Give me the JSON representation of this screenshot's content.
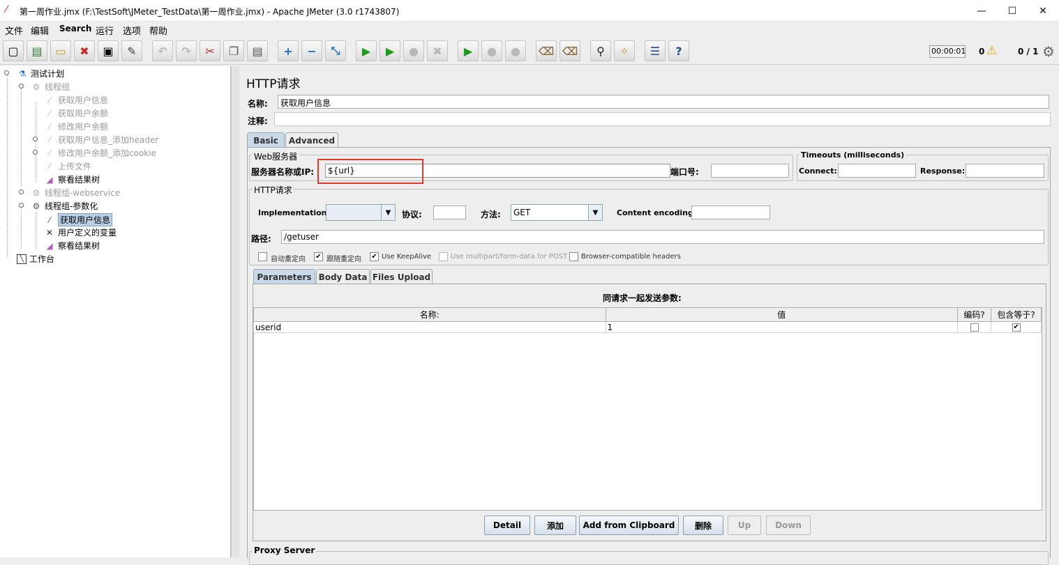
{
  "window": {
    "title": "第一周作业.jmx (F:\\TestSoft\\JMeter_TestData\\第一周作业.jmx) - Apache JMeter (3.0 r1743807)",
    "minimize": "—",
    "maximize": "☐",
    "close": "✕"
  },
  "menu": [
    "文件",
    "编辑",
    "Search",
    "运行",
    "选项",
    "帮助"
  ],
  "status": {
    "elapsed": "00:00:01",
    "warnings": "0",
    "threads": "0 / 1"
  },
  "tree": [
    {
      "label": "测试计划",
      "icon": "flask-icon"
    },
    {
      "label": "线程组",
      "icon": "gear-icon",
      "disabled": true
    },
    {
      "label": "获取用户信息",
      "icon": "pipette-icon",
      "disabled": true
    },
    {
      "label": "获取用户余额",
      "icon": "pipette-icon",
      "disabled": true
    },
    {
      "label": "修改用户余额",
      "icon": "pipette-icon",
      "disabled": true
    },
    {
      "label": "获取用户信息_添加header",
      "icon": "pipette-icon",
      "disabled": true
    },
    {
      "label": "修改用户余额_添加cookie",
      "icon": "pipette-icon",
      "disabled": true
    },
    {
      "label": "上传文件",
      "icon": "pipette-icon",
      "disabled": true
    },
    {
      "label": "察看结果树",
      "icon": "chart-icon"
    },
    {
      "label": "线程组-webservice",
      "icon": "gear-icon",
      "disabled": true
    },
    {
      "label": "线程组-参数化",
      "icon": "gear-icon"
    },
    {
      "label": "获取用户信息",
      "icon": "pipette-icon",
      "selected": true
    },
    {
      "label": "用户定义的变量",
      "icon": "tools-icon"
    },
    {
      "label": "察看结果树",
      "icon": "chart-icon"
    },
    {
      "label": "工作台",
      "icon": "workbench-icon"
    }
  ],
  "sampler": {
    "heading": "HTTP请求",
    "name_label": "名称:",
    "name_value": "获取用户信息",
    "comment_label": "注释:",
    "comment_value": "",
    "tabs": [
      "Basic",
      "Advanced"
    ],
    "web_server": {
      "group_label": "Web服务器",
      "server_label": "服务器名称或IP:",
      "server_value": "${url}",
      "port_label": "端口号:",
      "port_value": ""
    },
    "timeouts": {
      "group_label": "Timeouts (milliseconds)",
      "connect_label": "Connect:",
      "connect_value": "",
      "response_label": "Response:",
      "response_value": ""
    },
    "http": {
      "group_label": "HTTP请求",
      "impl_label": "Implementation:",
      "impl_value": "",
      "protocol_label": "协议:",
      "protocol_value": "",
      "method_label": "方法:",
      "method_value": "GET",
      "encoding_label": "Content encoding:",
      "encoding_value": "",
      "path_label": "路径:",
      "path_value": "/getuser",
      "options": [
        {
          "label": "自动重定向",
          "checked": false
        },
        {
          "label": "跟随重定向",
          "checked": true
        },
        {
          "label": "Use KeepAlive",
          "checked": true
        },
        {
          "label": "Use multipart/form-data for POST",
          "checked": false,
          "disabled": true
        },
        {
          "label": "Browser-compatible headers",
          "checked": false
        }
      ]
    },
    "param_tabs": [
      "Parameters",
      "Body Data",
      "Files Upload"
    ],
    "params_caption": "同请求一起发送参数:",
    "columns": [
      "名称:",
      "值",
      "编码?",
      "包含等于?"
    ],
    "rows": [
      {
        "name": "userid",
        "value": "1",
        "encode": false,
        "include_equals": true
      }
    ],
    "buttons": [
      "Detail",
      "添加",
      "Add from Clipboard",
      "删除",
      "Up",
      "Down"
    ],
    "proxy_label": "Proxy Server"
  },
  "colors": {
    "highlight_box": "#e0392c",
    "selected_tab": "#c9d9ea"
  }
}
